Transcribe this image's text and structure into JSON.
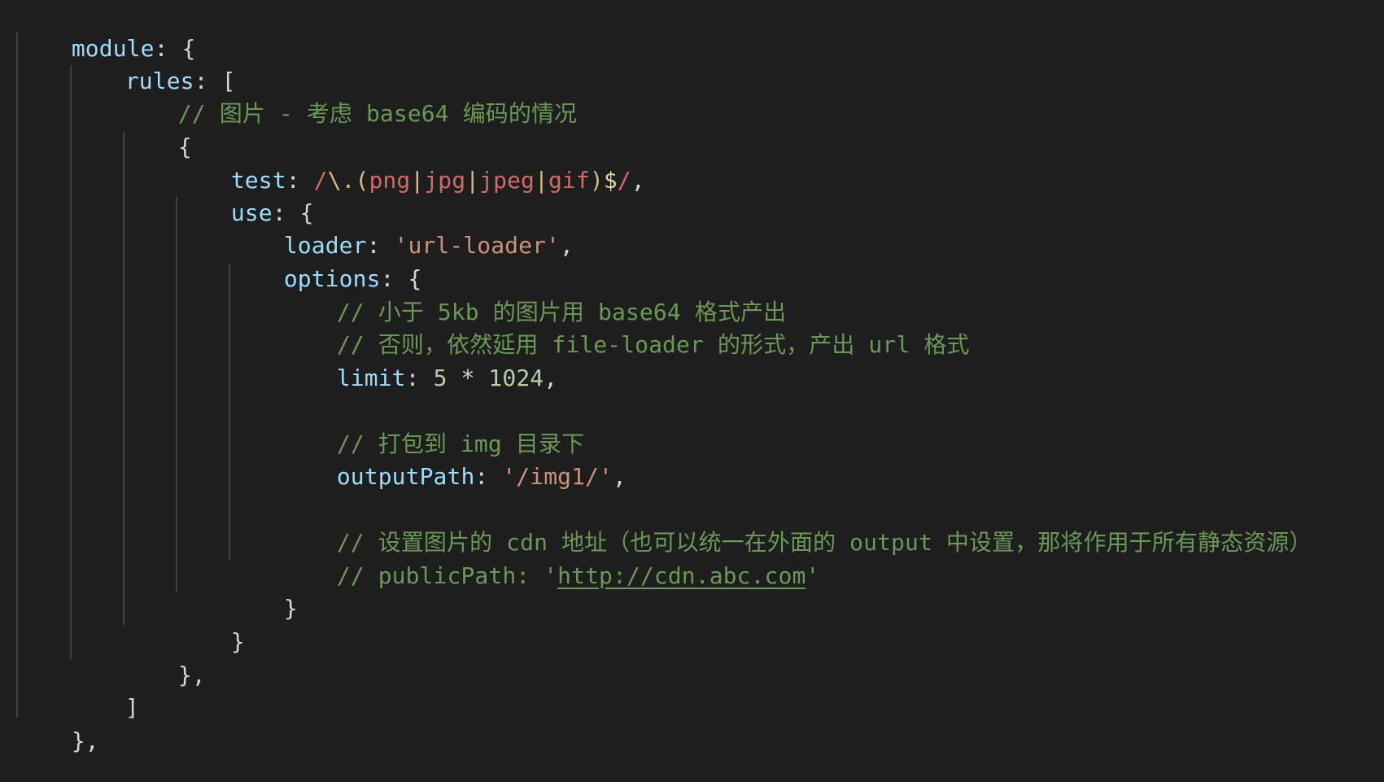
{
  "code": {
    "l1": {
      "key": "module",
      "colon": ": ",
      "brace": "{"
    },
    "l2": {
      "key": "rules",
      "colon": ": ",
      "bracket": "["
    },
    "l3": {
      "comment": "// 图片 - 考虑 base64 编码的情况"
    },
    "l4": {
      "brace": "{"
    },
    "l5": {
      "key": "test",
      "colon": ": ",
      "re_start": "/",
      "re_esc": "\\.",
      "re_open": "(",
      "alt1": "png",
      "pipe1": "|",
      "alt2": "jpg",
      "pipe2": "|",
      "alt3": "jpeg",
      "pipe3": "|",
      "alt4": "gif",
      "re_close": ")",
      "re_end": "$",
      "re_slash": "/",
      "comma": ","
    },
    "l6": {
      "key": "use",
      "colon": ": ",
      "brace": "{"
    },
    "l7": {
      "key": "loader",
      "colon": ": ",
      "value": "'url-loader'",
      "comma": ","
    },
    "l8": {
      "key": "options",
      "colon": ": ",
      "brace": "{"
    },
    "l9": {
      "comment": "// 小于 5kb 的图片用 base64 格式产出"
    },
    "l10": {
      "comment": "// 否则，依然延用 file-loader 的形式，产出 url 格式"
    },
    "l11": {
      "key": "limit",
      "colon": ": ",
      "n1": "5",
      "op": " * ",
      "n2": "1024",
      "comma": ","
    },
    "l13": {
      "comment": "// 打包到 img 目录下"
    },
    "l14": {
      "key": "outputPath",
      "colon": ": ",
      "value": "'/img1/'",
      "comma": ","
    },
    "l16": {
      "comment": "// 设置图片的 cdn 地址（也可以统一在外面的 output 中设置，那将作用于所有静态资源）"
    },
    "l17": {
      "comment_prefix": "// publicPath: '",
      "url": "http://cdn.abc.com",
      "comment_suffix": "'"
    },
    "l18": {
      "brace": "}"
    },
    "l19": {
      "brace": "}"
    },
    "l20": {
      "close": "},"
    },
    "l21": {
      "bracket": "]"
    },
    "l22": {
      "close": "},"
    }
  },
  "colors": {
    "background": "#1e1e1e",
    "key": "#9cdcfe",
    "string": "#ce9178",
    "number": "#b5cea8",
    "comment": "#6a9955",
    "regex": "#d16969",
    "punctuation": "#d4d4d4",
    "indent_guide": "#404040"
  }
}
